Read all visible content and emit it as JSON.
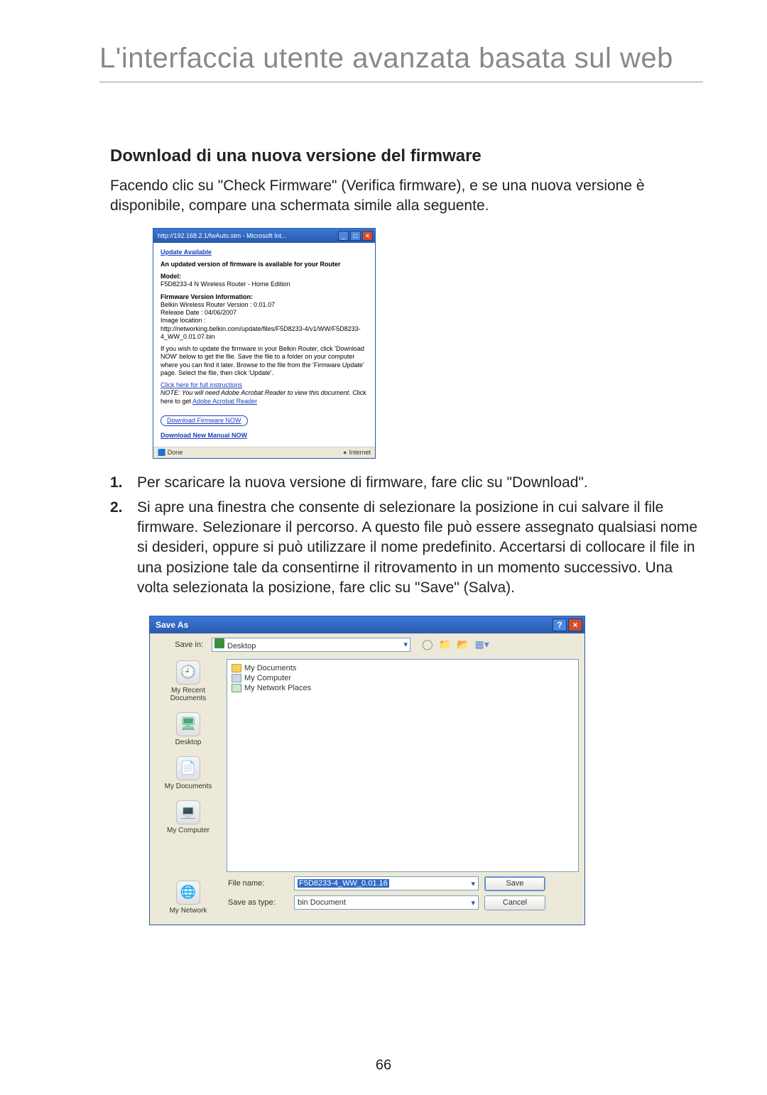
{
  "page": {
    "main_title": "L'interfaccia utente avanzata basata sul web",
    "section_heading": "Download di una nuova versione del firmware",
    "intro": "Facendo clic su \"Check Firmware\" (Verifica firmware), e se una nuova versione è disponibile, compare una schermata simile alla seguente.",
    "page_number": "66"
  },
  "ie": {
    "title": "http://192.168.2.1/fwAuto.stm - Microsoft Int...",
    "update_link": "Update Available",
    "update_text": "An updated version of firmware is available for your Router",
    "model_label": "Model:",
    "model_value": "F5D8233-4 N Wireless Router - Home Edition",
    "fw_info_label": "Firmware Version Information:",
    "fw_version": "Belkin Wireless Router Version : 0.01.07",
    "fw_release": "Release Date : 04/06/2007",
    "fw_imgloc_label": "Image location :",
    "fw_imgloc": "http://networking.belkin.com/update/files/F5D8233-4/v1/WW/F5D8233-4_WW_0.01.07.bin",
    "instructions": "If you wish to update the firmware in your Belkin Router, click 'Download NOW' below to get the file. Save the file to a folder on your computer where you can find it later. Browse to the file from the 'Firmware Update' page. Select the file, then click 'Update'.",
    "full_instr_link": "Click here for full instructions",
    "note_prefix": "NOTE: You will need Adobe Acrobat Reader to view this document. ",
    "note_click": "Click here to get ",
    "adobe_link": "Adobe Acrobat Reader",
    "dl_fw": "Download Firmware NOW",
    "dl_manual": "Download New Manual NOW",
    "status_done": "Done",
    "status_zone": "Internet"
  },
  "list": {
    "n1": "1.",
    "t1": "Per scaricare la nuova versione di firmware, fare clic su \"Download\".",
    "n2": "2.",
    "t2": "Si apre una finestra che consente di selezionare la posizione in cui salvare il file firmware. Selezionare il percorso. A questo file può essere assegnato qualsiasi nome si desideri, oppure si può utilizzare il nome predefinito. Accertarsi di collocare il file in una posizione tale da consentirne il ritrovamento in un momento successivo. Una volta selezionata la posizione, fare clic su \"Save\" (Salva)."
  },
  "saveas": {
    "title": "Save As",
    "savein_label": "Save in:",
    "savein_value": "Desktop",
    "places": {
      "recent": "My Recent Documents",
      "desktop": "Desktop",
      "mydocs": "My Documents",
      "mycomp": "My Computer",
      "mynet": "My Network"
    },
    "files": {
      "mydocs": "My Documents",
      "mycomp": "My Computer",
      "netplaces": "My Network Places"
    },
    "filename_label": "File name:",
    "filename_value": "F5D8233-4_WW_0.01.16",
    "saveastype_label": "Save as type:",
    "saveastype_value": "bin Document",
    "save_btn": "Save",
    "cancel_btn": "Cancel"
  }
}
